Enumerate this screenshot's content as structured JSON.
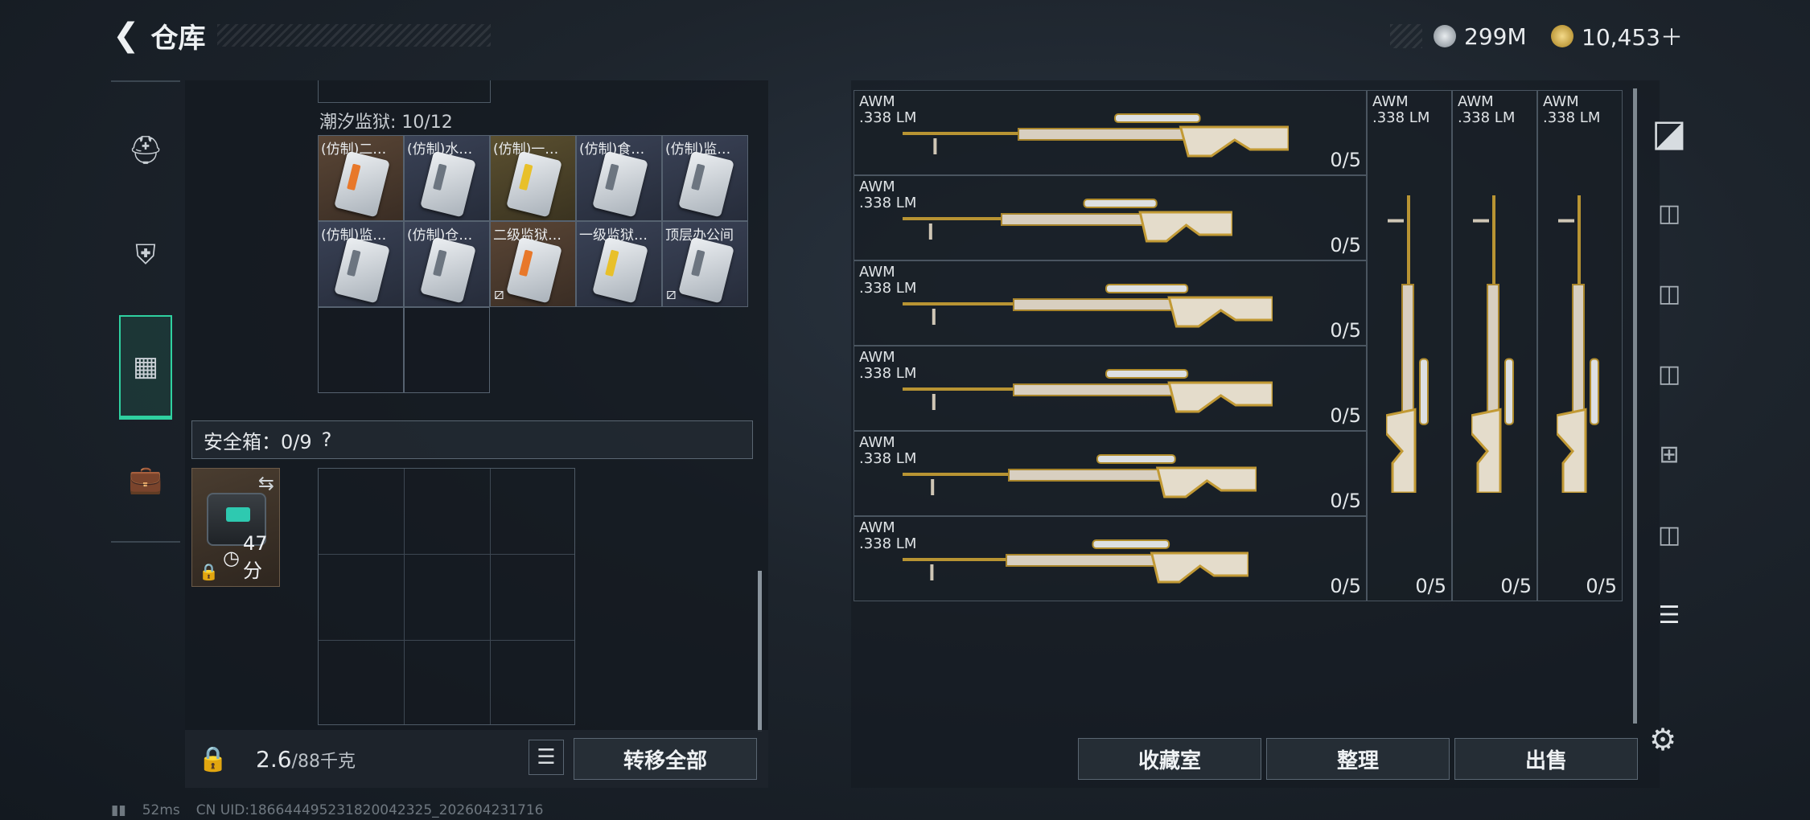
{
  "header": {
    "title": "仓库",
    "currency_silver": "299M",
    "currency_gold": "10,453＋"
  },
  "nav": {
    "items": [
      "pistol-icon",
      "armor-icon",
      "backpack-icon",
      "briefcase-icon"
    ],
    "active": 2
  },
  "tide_prison": {
    "label": "潮汐监狱: 10/12",
    "items": [
      {
        "label": "(仿制)二…",
        "color": "orange",
        "bg": "brown",
        "lost": false
      },
      {
        "label": "(仿制)水…",
        "color": "gray",
        "bg": "blue",
        "lost": false
      },
      {
        "label": "(仿制)一…",
        "color": "yellow",
        "bg": "gold",
        "lost": false
      },
      {
        "label": "(仿制)食…",
        "color": "gray",
        "bg": "blue",
        "lost": false
      },
      {
        "label": "(仿制)监…",
        "color": "gray",
        "bg": "blue",
        "lost": false
      },
      {
        "label": "(仿制)监…",
        "color": "gray",
        "bg": "blue",
        "lost": false
      },
      {
        "label": "(仿制)仓…",
        "color": "gray",
        "bg": "blue",
        "lost": false
      },
      {
        "label": "二级监狱…",
        "color": "orange",
        "bg": "brown",
        "lost": true
      },
      {
        "label": "一级监狱…",
        "color": "yellow",
        "bg": "blue",
        "lost": false
      },
      {
        "label": "顶层办公间",
        "color": "gray",
        "bg": "blue",
        "lost": true
      }
    ]
  },
  "safe_box": {
    "label": "安全箱：0/9",
    "help": "?",
    "timer": "47分"
  },
  "footer": {
    "weight": "2.6",
    "weight_max": "/88千克",
    "transfer_all": "转移全部"
  },
  "weapons": {
    "name_line1": "AWM",
    "name_line2": ".338 LM",
    "count": "0/5",
    "rows": 6,
    "vertical": 3
  },
  "right_buttons": {
    "collection": "收藏室",
    "organize": "整理",
    "sell": "出售"
  },
  "status": {
    "ping": "52ms",
    "uid": "CN UID:186644495231820042325_202604231716"
  },
  "colors": {
    "accent": "#2fd0a0",
    "gold": "#c9a43a"
  }
}
